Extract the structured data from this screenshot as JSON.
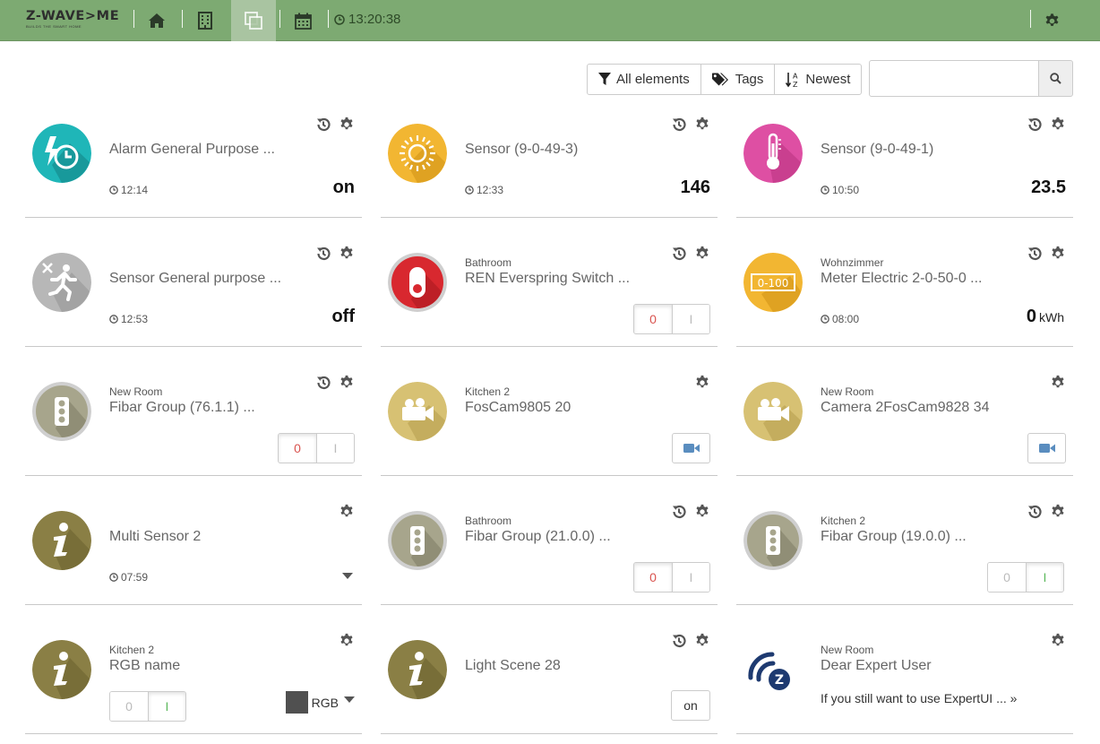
{
  "app": {
    "logo_text": "Z-WAVE>ME",
    "logo_tagline": "BUILDS THE SMART HOME",
    "clock": "13:20:38"
  },
  "nav": {
    "items": [
      {
        "name": "home",
        "icon": "home-icon"
      },
      {
        "name": "rooms",
        "icon": "building-icon"
      },
      {
        "name": "elements",
        "icon": "copy-icon",
        "active": true
      },
      {
        "name": "events",
        "icon": "calendar-icon"
      }
    ],
    "settings_icon": "gear-icon"
  },
  "filters": {
    "all": "All elements",
    "tags": "Tags",
    "sort": "Newest",
    "search_placeholder": "",
    "search_value": ""
  },
  "colors": {
    "navbar": "#7daa72",
    "switch_off": "#d9534f",
    "switch_on": "#5cb85c",
    "camera": "#5a8dbf"
  },
  "widgets": [
    {
      "room": "",
      "title": "Alarm General Purpose ...",
      "time": "12:14",
      "value": "on",
      "unit": "",
      "icon": "alarm-clock-icon",
      "icon_color": "#1fb6b8"
    },
    {
      "room": "",
      "title": "Sensor (9-0-49-3)",
      "time": "12:33",
      "value": "146",
      "unit": "",
      "icon": "luminosity-icon",
      "icon_color": "#f2b632"
    },
    {
      "room": "",
      "title": "Sensor (9-0-49-1)",
      "time": "10:50",
      "value": "23.5",
      "unit": "",
      "icon": "thermometer-icon",
      "icon_color": "#de4fa3"
    },
    {
      "room": "",
      "title": "Sensor General purpose ...",
      "time": "12:53",
      "value": "off",
      "unit": "",
      "icon": "motion-icon",
      "icon_color": "#b7b7b7"
    },
    {
      "room": "Bathroom",
      "title": "REN Everspring Switch ...",
      "switch_off": "0",
      "switch_on": "I",
      "switch_state": "off",
      "icon": "switch-icon",
      "icon_color": "#d8282f"
    },
    {
      "room": "Wohnzimmer",
      "title": "Meter Electric 2-0-50-0 ...",
      "time": "08:00",
      "value": "0",
      "unit": "kWh",
      "icon": "meter-icon",
      "icon_color": "#f2b632",
      "icon_label": "0-100"
    },
    {
      "room": "New Room",
      "title": "Fibar Group (76.1.1) ...",
      "switch_off": "0",
      "switch_on": "I",
      "switch_state": "off",
      "icon": "traffic-light-icon",
      "icon_color": "#a7a58c"
    },
    {
      "room": "Kitchen 2",
      "title": "FosCam9805 20",
      "icon": "camera-icon",
      "icon_color": "#d7c173"
    },
    {
      "room": "New Room",
      "title": "Camera 2FosCam9828 34",
      "icon": "camera-icon",
      "icon_color": "#d7c173"
    },
    {
      "room": "",
      "title": "Multi Sensor 2",
      "time": "07:59",
      "icon": "info-icon",
      "icon_color": "#8a7f45"
    },
    {
      "room": "Bathroom",
      "title": "Fibar Group (21.0.0) ...",
      "switch_off": "0",
      "switch_on": "I",
      "switch_state": "off",
      "icon": "traffic-light-icon",
      "icon_color": "#a7a58c"
    },
    {
      "room": "Kitchen 2",
      "title": "Fibar Group (19.0.0) ...",
      "switch_off": "0",
      "switch_on": "I",
      "switch_state": "on",
      "icon": "traffic-light-icon",
      "icon_color": "#a7a58c"
    },
    {
      "room": "Kitchen 2",
      "title": "RGB name",
      "switch_off": "0",
      "switch_on": "I",
      "switch_state": "on",
      "rgb_label": "RGB",
      "rgb_color": "#505050",
      "icon": "info-icon",
      "icon_color": "#8a7f45"
    },
    {
      "room": "",
      "title": "Light Scene 28",
      "button_label": "on",
      "icon": "info-icon",
      "icon_color": "#8a7f45"
    },
    {
      "room": "New Room",
      "title": "Dear Expert User",
      "message": "If you still want to use ExpertUI ... »",
      "icon": "zwave-logo-icon",
      "icon_color": "#1e3a70"
    }
  ]
}
